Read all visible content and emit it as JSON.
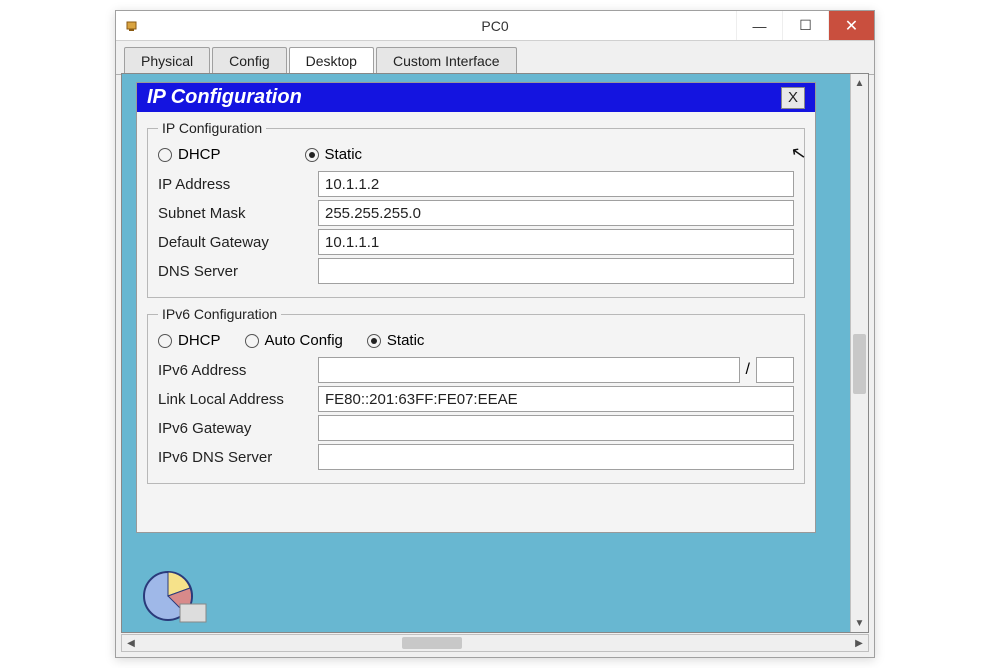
{
  "window": {
    "title": "PC0"
  },
  "tabs": {
    "physical": "Physical",
    "config": "Config",
    "desktop": "Desktop",
    "custom": "Custom Interface",
    "active": "desktop"
  },
  "modal": {
    "title": "IP Configuration",
    "close": "X"
  },
  "ipv4": {
    "legend": "IP Configuration",
    "dhcp_label": "DHCP",
    "static_label": "Static",
    "mode": "static",
    "ip_label": "IP Address",
    "ip_value": "10.1.1.2",
    "mask_label": "Subnet Mask",
    "mask_value": "255.255.255.0",
    "gw_label": "Default Gateway",
    "gw_value": "10.1.1.1",
    "dns_label": "DNS Server",
    "dns_value": ""
  },
  "ipv6": {
    "legend": "IPv6 Configuration",
    "dhcp_label": "DHCP",
    "auto_label": "Auto Config",
    "static_label": "Static",
    "mode": "static",
    "addr_label": "IPv6 Address",
    "addr_value": "",
    "prefix_value": "",
    "ll_label": "Link Local Address",
    "ll_value": "FE80::201:63FF:FE07:EEAE",
    "gw_label": "IPv6 Gateway",
    "gw_value": "",
    "dns_label": "IPv6 DNS Server",
    "dns_value": ""
  }
}
